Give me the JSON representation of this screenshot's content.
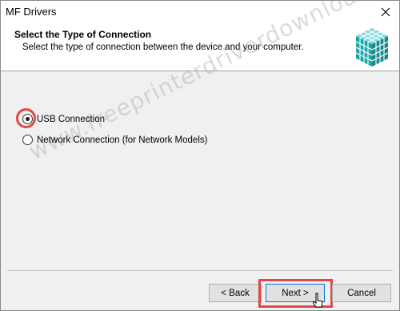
{
  "window": {
    "title": "MF Drivers"
  },
  "header": {
    "title": "Select the Type of Connection",
    "subtitle": "Select the type of connection between the device and your computer."
  },
  "options": {
    "usb": {
      "label": "USB Connection",
      "selected": true
    },
    "network": {
      "label": "Network Connection (for Network Models)",
      "selected": false
    }
  },
  "watermark": "www.freeprinterdriverdownload.org",
  "buttons": {
    "back": "< Back",
    "next": "Next >",
    "cancel": "Cancel"
  },
  "colors": {
    "highlight": "#e04848",
    "focus": "#0078d7"
  }
}
